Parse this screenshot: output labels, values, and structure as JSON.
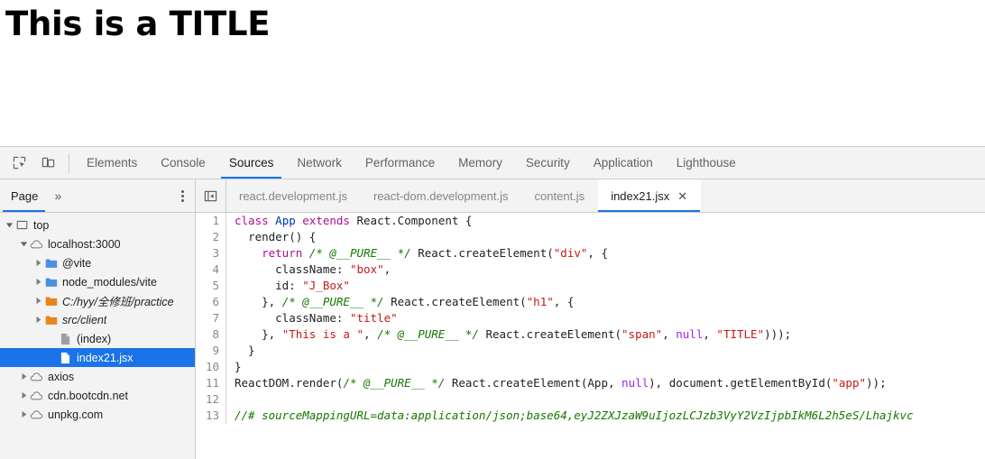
{
  "page": {
    "title": "This is a TITLE"
  },
  "devtools": {
    "toolbar": {
      "inspect_icon": "inspect-element-icon",
      "device_icon": "device-toolbar-icon",
      "tabs": [
        {
          "label": "Elements",
          "selected": false
        },
        {
          "label": "Console",
          "selected": false
        },
        {
          "label": "Sources",
          "selected": true
        },
        {
          "label": "Network",
          "selected": false
        },
        {
          "label": "Performance",
          "selected": false
        },
        {
          "label": "Memory",
          "selected": false
        },
        {
          "label": "Security",
          "selected": false
        },
        {
          "label": "Application",
          "selected": false
        },
        {
          "label": "Lighthouse",
          "selected": false
        }
      ]
    },
    "navigator_header": {
      "tab_label": "Page",
      "more_label": "»",
      "more_icon": "chevron-double-right-icon",
      "menu_icon": "more-options-kebab-icon"
    },
    "editor_tabs": {
      "panel_toggle_icon": "show-navigator-panel-icon",
      "tabs": [
        {
          "label": "react.development.js",
          "selected": false,
          "closable": false
        },
        {
          "label": "react-dom.development.js",
          "selected": false,
          "closable": false
        },
        {
          "label": "content.js",
          "selected": false,
          "closable": false
        },
        {
          "label": "index21.jsx",
          "selected": true,
          "closable": true
        }
      ],
      "close_glyph": "✕"
    },
    "navigator_tree": [
      {
        "label": "top",
        "depth": 0,
        "icon": "frame-icon",
        "twisty": "open",
        "italic": false,
        "selected": false
      },
      {
        "label": "localhost:3000",
        "depth": 1,
        "icon": "cloud-icon",
        "twisty": "open",
        "italic": false,
        "selected": false
      },
      {
        "label": "@vite",
        "depth": 2,
        "icon": "folder-blue-icon",
        "twisty": "closed",
        "italic": false,
        "selected": false
      },
      {
        "label": "node_modules/vite",
        "depth": 2,
        "icon": "folder-blue-icon",
        "twisty": "closed",
        "italic": false,
        "selected": false
      },
      {
        "label": "C:/hyy/全修班/practice",
        "depth": 2,
        "icon": "folder-orange-icon",
        "twisty": "closed",
        "italic": true,
        "selected": false
      },
      {
        "label": "src/client",
        "depth": 2,
        "icon": "folder-orange-icon",
        "twisty": "closed",
        "italic": true,
        "selected": false
      },
      {
        "label": "(index)",
        "depth": 3,
        "icon": "file-gray-icon",
        "twisty": "none",
        "italic": false,
        "selected": false
      },
      {
        "label": "index21.jsx",
        "depth": 3,
        "icon": "file-blue-icon",
        "twisty": "none",
        "italic": false,
        "selected": true
      },
      {
        "label": "axios",
        "depth": 1,
        "icon": "cloud-icon",
        "twisty": "closed",
        "italic": false,
        "selected": false
      },
      {
        "label": "cdn.bootcdn.net",
        "depth": 1,
        "icon": "cloud-icon",
        "twisty": "closed",
        "italic": false,
        "selected": false
      },
      {
        "label": "unpkg.com",
        "depth": 1,
        "icon": "cloud-icon",
        "twisty": "closed",
        "italic": false,
        "selected": false
      }
    ],
    "code": {
      "filename": "index21.jsx",
      "lines": [
        {
          "n": 1,
          "text": "class App extends React.Component {"
        },
        {
          "n": 2,
          "text": "  render() {"
        },
        {
          "n": 3,
          "text": "    return /* @__PURE__ */ React.createElement(\"div\", {"
        },
        {
          "n": 4,
          "text": "      className: \"box\","
        },
        {
          "n": 5,
          "text": "      id: \"J_Box\""
        },
        {
          "n": 6,
          "text": "    }, /* @__PURE__ */ React.createElement(\"h1\", {"
        },
        {
          "n": 7,
          "text": "      className: \"title\""
        },
        {
          "n": 8,
          "text": "    }, \"This is a \", /* @__PURE__ */ React.createElement(\"span\", null, \"TITLE\")));"
        },
        {
          "n": 9,
          "text": "  }"
        },
        {
          "n": 10,
          "text": "}"
        },
        {
          "n": 11,
          "text": "ReactDOM.render(/* @__PURE__ */ React.createElement(App, null), document.getElementById(\"app\"));"
        },
        {
          "n": 12,
          "text": ""
        },
        {
          "n": 13,
          "text": "//# sourceMappingURL=data:application/json;base64,eyJ2ZXJzaW9uIjozLCJzb3VyY2VzIjpbIkM6L2h5eS/Lhajkvc"
        }
      ]
    }
  },
  "colors": {
    "accent": "#1a73e8",
    "toolbar_bg": "#f3f3f3",
    "border": "#cdcdcd",
    "keyword": "#aa0d91",
    "string": "#c41a16",
    "comment": "#177500",
    "atom": "#a020f0",
    "definition": "#0033b3",
    "folder_blue": "#4d90e0",
    "folder_orange": "#e8851b",
    "selection_bg": "#1a73e8"
  }
}
